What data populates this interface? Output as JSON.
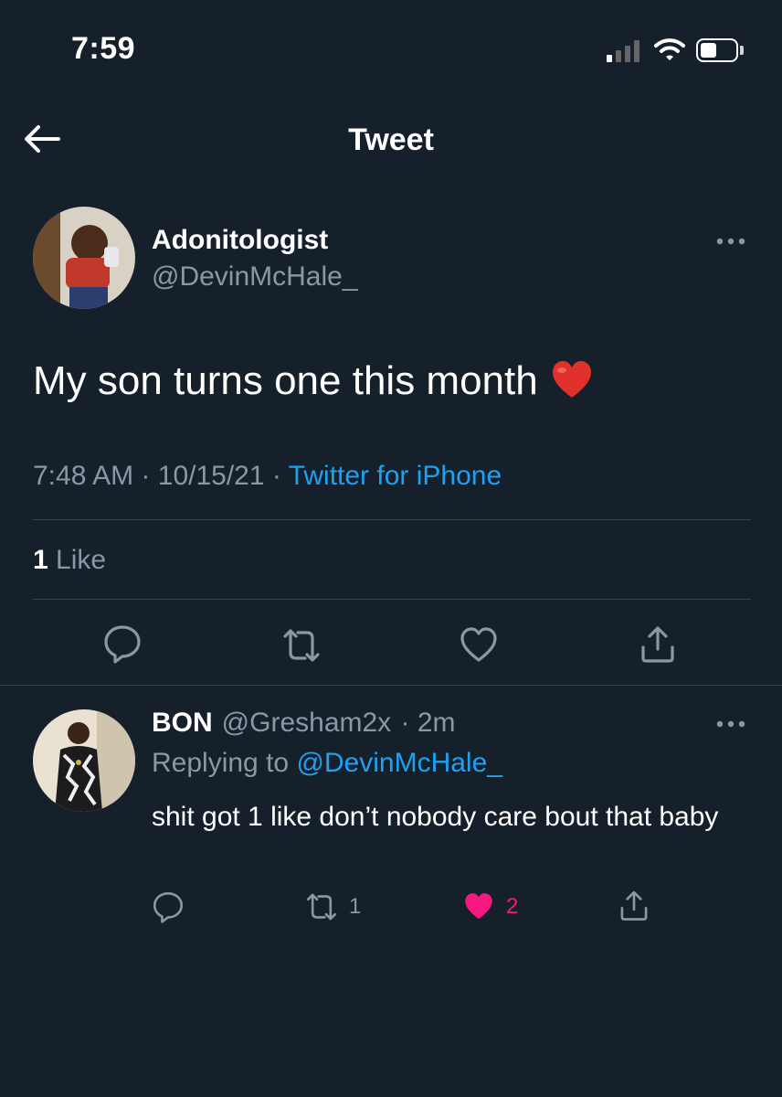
{
  "status_bar": {
    "time": "7:59"
  },
  "header": {
    "title": "Tweet"
  },
  "tweet": {
    "display_name": "Adonitologist",
    "handle": "@DevinMcHale_",
    "text": "My son turns one this month",
    "emoji": "red-heart-emoji",
    "time": "7:48 AM",
    "date": "10/15/21",
    "separator": "·",
    "source": "Twitter for iPhone",
    "like_count": "1",
    "like_label": "Like"
  },
  "reply": {
    "display_name": "BON",
    "handle": "@Gresham2x",
    "age": "· 2m",
    "replying_prefix": "Replying to",
    "replying_to": "@DevinMcHale_",
    "text": "shit got 1 like don’t nobody care bout that baby",
    "retweet_count": "1",
    "like_count": "2"
  },
  "colors": {
    "background": "#15202b",
    "accent": "#1da1f2",
    "secondary_text": "#8899a6",
    "like_pink": "#f91880",
    "divider": "#38444d"
  }
}
